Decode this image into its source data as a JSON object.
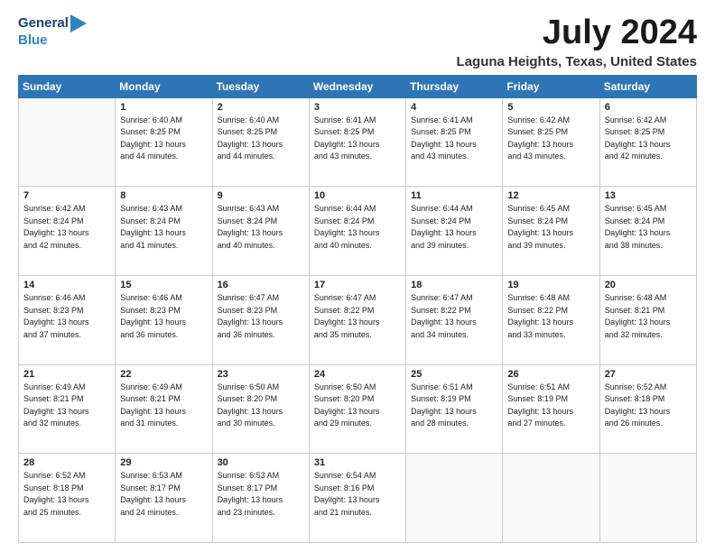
{
  "logo": {
    "line1": "General",
    "line2": "Blue"
  },
  "title": "July 2024",
  "location": "Laguna Heights, Texas, United States",
  "weekdays": [
    "Sunday",
    "Monday",
    "Tuesday",
    "Wednesday",
    "Thursday",
    "Friday",
    "Saturday"
  ],
  "weeks": [
    [
      {
        "day": "",
        "info": ""
      },
      {
        "day": "1",
        "info": "Sunrise: 6:40 AM\nSunset: 8:25 PM\nDaylight: 13 hours\nand 44 minutes."
      },
      {
        "day": "2",
        "info": "Sunrise: 6:40 AM\nSunset: 8:25 PM\nDaylight: 13 hours\nand 44 minutes."
      },
      {
        "day": "3",
        "info": "Sunrise: 6:41 AM\nSunset: 8:25 PM\nDaylight: 13 hours\nand 43 minutes."
      },
      {
        "day": "4",
        "info": "Sunrise: 6:41 AM\nSunset: 8:25 PM\nDaylight: 13 hours\nand 43 minutes."
      },
      {
        "day": "5",
        "info": "Sunrise: 6:42 AM\nSunset: 8:25 PM\nDaylight: 13 hours\nand 43 minutes."
      },
      {
        "day": "6",
        "info": "Sunrise: 6:42 AM\nSunset: 8:25 PM\nDaylight: 13 hours\nand 42 minutes."
      }
    ],
    [
      {
        "day": "7",
        "info": "Sunrise: 6:42 AM\nSunset: 8:24 PM\nDaylight: 13 hours\nand 42 minutes."
      },
      {
        "day": "8",
        "info": "Sunrise: 6:43 AM\nSunset: 8:24 PM\nDaylight: 13 hours\nand 41 minutes."
      },
      {
        "day": "9",
        "info": "Sunrise: 6:43 AM\nSunset: 8:24 PM\nDaylight: 13 hours\nand 40 minutes."
      },
      {
        "day": "10",
        "info": "Sunrise: 6:44 AM\nSunset: 8:24 PM\nDaylight: 13 hours\nand 40 minutes."
      },
      {
        "day": "11",
        "info": "Sunrise: 6:44 AM\nSunset: 8:24 PM\nDaylight: 13 hours\nand 39 minutes."
      },
      {
        "day": "12",
        "info": "Sunrise: 6:45 AM\nSunset: 8:24 PM\nDaylight: 13 hours\nand 39 minutes."
      },
      {
        "day": "13",
        "info": "Sunrise: 6:45 AM\nSunset: 8:24 PM\nDaylight: 13 hours\nand 38 minutes."
      }
    ],
    [
      {
        "day": "14",
        "info": "Sunrise: 6:46 AM\nSunset: 8:23 PM\nDaylight: 13 hours\nand 37 minutes."
      },
      {
        "day": "15",
        "info": "Sunrise: 6:46 AM\nSunset: 8:23 PM\nDaylight: 13 hours\nand 36 minutes."
      },
      {
        "day": "16",
        "info": "Sunrise: 6:47 AM\nSunset: 8:23 PM\nDaylight: 13 hours\nand 36 minutes."
      },
      {
        "day": "17",
        "info": "Sunrise: 6:47 AM\nSunset: 8:22 PM\nDaylight: 13 hours\nand 35 minutes."
      },
      {
        "day": "18",
        "info": "Sunrise: 6:47 AM\nSunset: 8:22 PM\nDaylight: 13 hours\nand 34 minutes."
      },
      {
        "day": "19",
        "info": "Sunrise: 6:48 AM\nSunset: 8:22 PM\nDaylight: 13 hours\nand 33 minutes."
      },
      {
        "day": "20",
        "info": "Sunrise: 6:48 AM\nSunset: 8:21 PM\nDaylight: 13 hours\nand 32 minutes."
      }
    ],
    [
      {
        "day": "21",
        "info": "Sunrise: 6:49 AM\nSunset: 8:21 PM\nDaylight: 13 hours\nand 32 minutes."
      },
      {
        "day": "22",
        "info": "Sunrise: 6:49 AM\nSunset: 8:21 PM\nDaylight: 13 hours\nand 31 minutes."
      },
      {
        "day": "23",
        "info": "Sunrise: 6:50 AM\nSunset: 8:20 PM\nDaylight: 13 hours\nand 30 minutes."
      },
      {
        "day": "24",
        "info": "Sunrise: 6:50 AM\nSunset: 8:20 PM\nDaylight: 13 hours\nand 29 minutes."
      },
      {
        "day": "25",
        "info": "Sunrise: 6:51 AM\nSunset: 8:19 PM\nDaylight: 13 hours\nand 28 minutes."
      },
      {
        "day": "26",
        "info": "Sunrise: 6:51 AM\nSunset: 8:19 PM\nDaylight: 13 hours\nand 27 minutes."
      },
      {
        "day": "27",
        "info": "Sunrise: 6:52 AM\nSunset: 8:18 PM\nDaylight: 13 hours\nand 26 minutes."
      }
    ],
    [
      {
        "day": "28",
        "info": "Sunrise: 6:52 AM\nSunset: 8:18 PM\nDaylight: 13 hours\nand 25 minutes."
      },
      {
        "day": "29",
        "info": "Sunrise: 6:53 AM\nSunset: 8:17 PM\nDaylight: 13 hours\nand 24 minutes."
      },
      {
        "day": "30",
        "info": "Sunrise: 6:53 AM\nSunset: 8:17 PM\nDaylight: 13 hours\nand 23 minutes."
      },
      {
        "day": "31",
        "info": "Sunrise: 6:54 AM\nSunset: 8:16 PM\nDaylight: 13 hours\nand 21 minutes."
      },
      {
        "day": "",
        "info": ""
      },
      {
        "day": "",
        "info": ""
      },
      {
        "day": "",
        "info": ""
      }
    ]
  ]
}
